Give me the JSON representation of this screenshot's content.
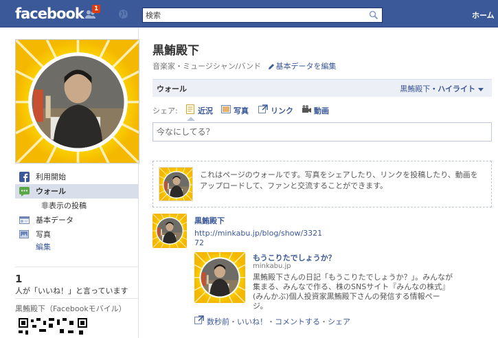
{
  "topbar": {
    "logo": "facebook",
    "notification_count": "1",
    "search_placeholder": "検索",
    "home_label": "ホーム"
  },
  "sidebar": {
    "items": [
      {
        "label": "利用開始",
        "icon": "facebook-icon"
      },
      {
        "label": "ウォール",
        "icon": "wall-icon"
      },
      {
        "label": "非表示の投稿"
      },
      {
        "label": "基本データ",
        "icon": "info-icon"
      },
      {
        "label": "写真",
        "icon": "photo-icon"
      },
      {
        "label": "編集"
      }
    ],
    "likes_count": "1",
    "likes_text": "人が「いいね！」と言っています",
    "mobile_title": "黒鮪殿下（Facebookモバイル）"
  },
  "page": {
    "name": "黒鮪殿下",
    "category": "音楽家・ミュージシャン/バンド",
    "edit_basic": "基本データを編集"
  },
  "wall": {
    "title": "ウォール",
    "filter_name": "黒鮪殿下",
    "filter_label": "・ハイライト"
  },
  "share": {
    "label": "シェア:",
    "options": [
      "近況",
      "写真",
      "リンク",
      "動画"
    ]
  },
  "status": {
    "placeholder": "今なにしてる？"
  },
  "info_text": "これはページのウォールです。写真をシェアしたり、リンクを投稿したり、動画をアップロードして、ファンと交流することができます。",
  "post": {
    "author": "黒鮪殿下",
    "link": "http://minkabu.jp/blog/show/332172",
    "attachment_title": "もうこりたでしょうか？",
    "attachment_domain": "minkabu.jp",
    "attachment_desc": "黒鮪殿下さんの日記「もうこりたでしょうか？」。みんなが集まる、みんなで作る、株のSNSサイト『みんなの株式』(みんかぶ)個人投資家黒鮪殿下さんの発信する情報ページ。",
    "time": "数秒前",
    "sep1": "・",
    "like": "いいね！",
    "sep2": "・",
    "comment": "コメントする",
    "sep3": "・",
    "share": "シェア"
  },
  "colors": {
    "brand": "#3b5998",
    "badge": "#dd3c10",
    "frame_yellow": "#ffd400"
  }
}
